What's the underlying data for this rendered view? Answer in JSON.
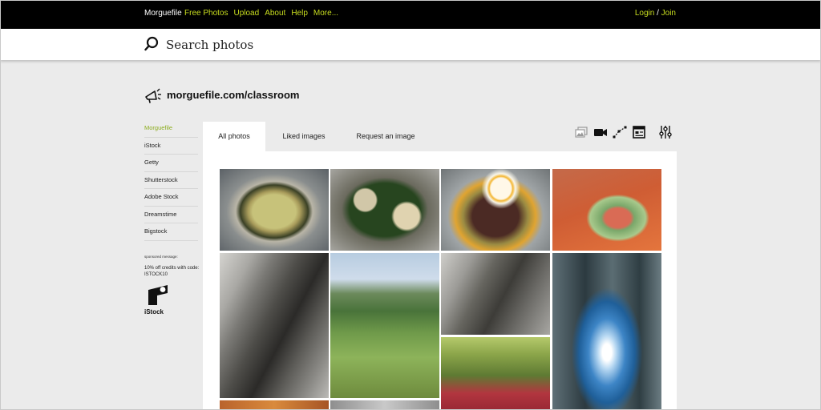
{
  "topnav": {
    "brand": "Morguefile",
    "links": [
      "Free Photos",
      "Upload",
      "About",
      "Help",
      "More..."
    ],
    "login": "Login",
    "separator": "/",
    "join": "Join"
  },
  "search": {
    "placeholder": "Search photos"
  },
  "page": {
    "title": "morguefile.com/classroom"
  },
  "sidebar": {
    "items": [
      "Morguefile",
      "iStock",
      "Getty",
      "Shutterstock",
      "Adobe Stock",
      "Dreamstime",
      "Bigstock"
    ],
    "active_index": 0,
    "sponsored_label": "sponsored message:",
    "sponsor_text": "10% off credits with code: ISTOCK10",
    "sponsor_name": "iStock"
  },
  "tabs": [
    "All photos",
    "Liked images",
    "Request an image"
  ],
  "tools": [
    "images-icon",
    "video-icon",
    "vector-icon",
    "template-icon",
    "filter-sliders-icon"
  ],
  "colors": {
    "nav_background": "#000000",
    "accent": "#c9de1f",
    "active_sidebar": "#8cac1e",
    "page_background": "#ebebeb"
  }
}
